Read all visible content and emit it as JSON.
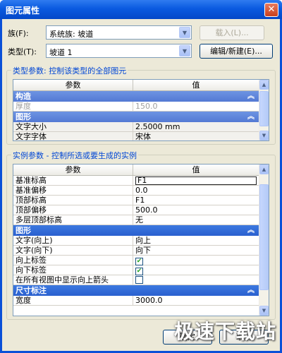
{
  "window": {
    "title": "图元属性",
    "close_glyph": "✕"
  },
  "family": {
    "label": "族(F):",
    "value": "系统族: 坡道"
  },
  "type": {
    "label": "类型(T):",
    "value": "坡道 1"
  },
  "buttons": {
    "load": "载入(L)...",
    "edit_new": "编辑/新建(E)...",
    "ok": "确定",
    "cancel": "取消"
  },
  "type_params": {
    "group_label": "类型参数: 控制该类型的全部图元",
    "header_param": "参数",
    "header_value": "值",
    "groups": [
      {
        "name": "构造",
        "rows": [
          {
            "param": "厚度",
            "value": "150.0"
          }
        ]
      },
      {
        "name": "图形",
        "rows": [
          {
            "param": "文字大小",
            "value": "2.5000 mm"
          },
          {
            "param": "文字字体",
            "value": "宋体"
          }
        ]
      }
    ]
  },
  "instance_params": {
    "group_label": "实例参数 - 控制所选或要生成的实例",
    "header_param": "参数",
    "header_value": "值",
    "constraint_rows": [
      {
        "param": "基准标高",
        "value": "F1"
      },
      {
        "param": "基准偏移",
        "value": "0.0"
      },
      {
        "param": "顶部标高",
        "value": "F1"
      },
      {
        "param": "顶部偏移",
        "value": "500.0"
      },
      {
        "param": "多层顶部标高",
        "value": "无"
      }
    ],
    "graphics_group": "图形",
    "graphics_rows": [
      {
        "param": "文字(向上)",
        "value": "向上"
      },
      {
        "param": "文字(向下)",
        "value": "向下"
      },
      {
        "param": "向上标签",
        "checked": true
      },
      {
        "param": "向下标签",
        "checked": true
      },
      {
        "param": "在所有视图中显示向上箭头",
        "checked": false
      }
    ],
    "dimension_group": "尺寸标注",
    "dimension_rows": [
      {
        "param": "宽度",
        "value": "3000.0"
      }
    ]
  },
  "watermark": "极速下载站"
}
